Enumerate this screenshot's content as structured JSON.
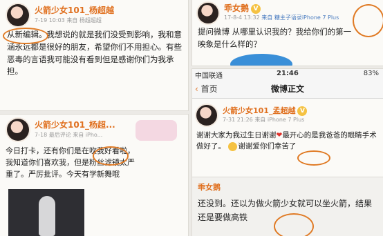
{
  "panel1": {
    "name": "火箭少女101_杨超越",
    "time": "7-19 10:03",
    "source": "来自 杨超超超",
    "text": "从新编辑。我想说的就是我们没受到影响，我和意涵永远都是很好的朋友，希望你们不用担心。有些恶毒的言语我可能没有看到但是感谢你们为我承担。"
  },
  "panel2": {
    "name": "乖女鹅",
    "time": "17-8-4 13:32",
    "source": "来自 糖主子语录iPhone 7 Plus",
    "text": "提问微博 从哪里认识我的？我给你们的第一映象是什么样的？"
  },
  "panel3": {
    "name": "火箭少女101_杨超...",
    "time": "7-18",
    "source": "最后评论 来自 iPho...",
    "text": "今日打卡，还有你们是在吹我好看啦，我知道你们喜欢我，但是粉丝滤镜太严重了。严厉批评。今天有学新舞哦"
  },
  "panel4": {
    "status_carrier": "中国联通",
    "status_time": "21:46",
    "status_battery": "83%",
    "back_label": "首页",
    "title": "微博正文",
    "name": "火箭少女101_孟超越",
    "time": "7-31 21:26",
    "source": "来自 iPhone 7 Plus",
    "text1": "谢谢大家为我过生日谢谢",
    "text2": "最开心的是我爸爸的眼睛手术做好了。",
    "text3": "谢谢爱你们幸苦了",
    "reply_name": "乖女鹅",
    "reply_text": "还没到。还以为做火箭少女就可以坐火箭，结果还是要做高铁"
  },
  "colors": {
    "accent": "#e0701f",
    "circle": "#e07a24"
  }
}
